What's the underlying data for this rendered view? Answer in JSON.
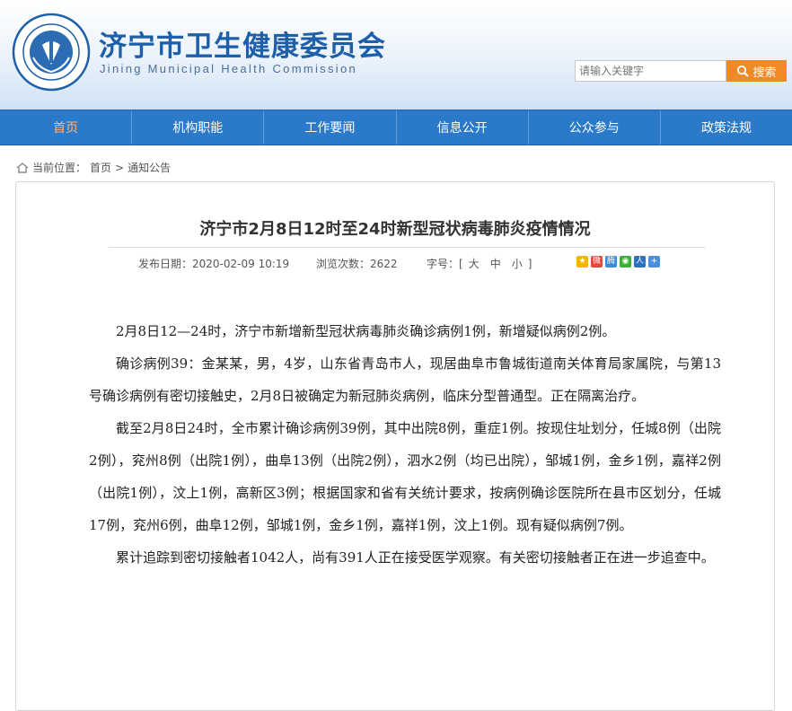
{
  "header": {
    "title": "济宁市卫生健康委员会",
    "subtitle": "Jining Municipal Health Commission",
    "search_placeholder": "请输入关键字",
    "search_button": "搜索"
  },
  "nav": {
    "items": [
      {
        "label": "首页"
      },
      {
        "label": "机构职能"
      },
      {
        "label": "工作要闻"
      },
      {
        "label": "信息公开"
      },
      {
        "label": "公众参与"
      },
      {
        "label": "政策法规"
      }
    ]
  },
  "breadcrumb": {
    "prefix": "当前位置：",
    "home": "首页",
    "sep": ">",
    "current": "通知公告"
  },
  "article": {
    "title": "济宁市2月8日12时至24时新型冠状病毒肺炎疫情情况",
    "date_label": "发布日期：",
    "date": "2020-02-09 10:19",
    "views_label": "浏览次数：",
    "views": "2622",
    "fontsize_label": "字号：[",
    "fontsize_large": "大",
    "fontsize_medium": "中",
    "fontsize_small": "小",
    "fontsize_end": "]",
    "paragraphs": [
      "2月8日12—24时，济宁市新增新型冠状病毒肺炎确诊病例1例，新增疑似病例2例。",
      "确诊病例39：金某某，男，4岁，山东省青岛市人，现居曲阜市鲁城街道南关体育局家属院，与第13号确诊病例有密切接触史，2月8日被确定为新冠肺炎病例，临床分型普通型。正在隔离治疗。",
      "截至2月8日24时，全市累计确诊病例39例，其中出院8例，重症1例。按现住址划分，任城8例（出院2例），兖州8例（出院1例），曲阜13例（出院2例），泗水2例（均已出院），邹城1例，金乡1例，嘉祥2例（出院1例），汶上1例，高新区3例；根据国家和省有关统计要求，按病例确诊医院所在县市区划分，任城17例，兖州6例，曲阜12例，邹城1例，金乡1例，嘉祥1例，汶上1例。现有疑似病例7例。",
      "累计追踪到密切接触者1042人，尚有391人正在接受医学观察。有关密切接触者正在进一步追查中。"
    ]
  },
  "share_icons": [
    "qzone-icon",
    "weibo-icon",
    "tencent-weibo-icon",
    "wechat-icon",
    "renren-icon",
    "more-share-icon"
  ],
  "colors": {
    "brand_blue": "#1d5fa8",
    "nav_blue": "#2b7ac9",
    "search_orange": "#f08a24",
    "nav_active": "#ffb37a"
  }
}
